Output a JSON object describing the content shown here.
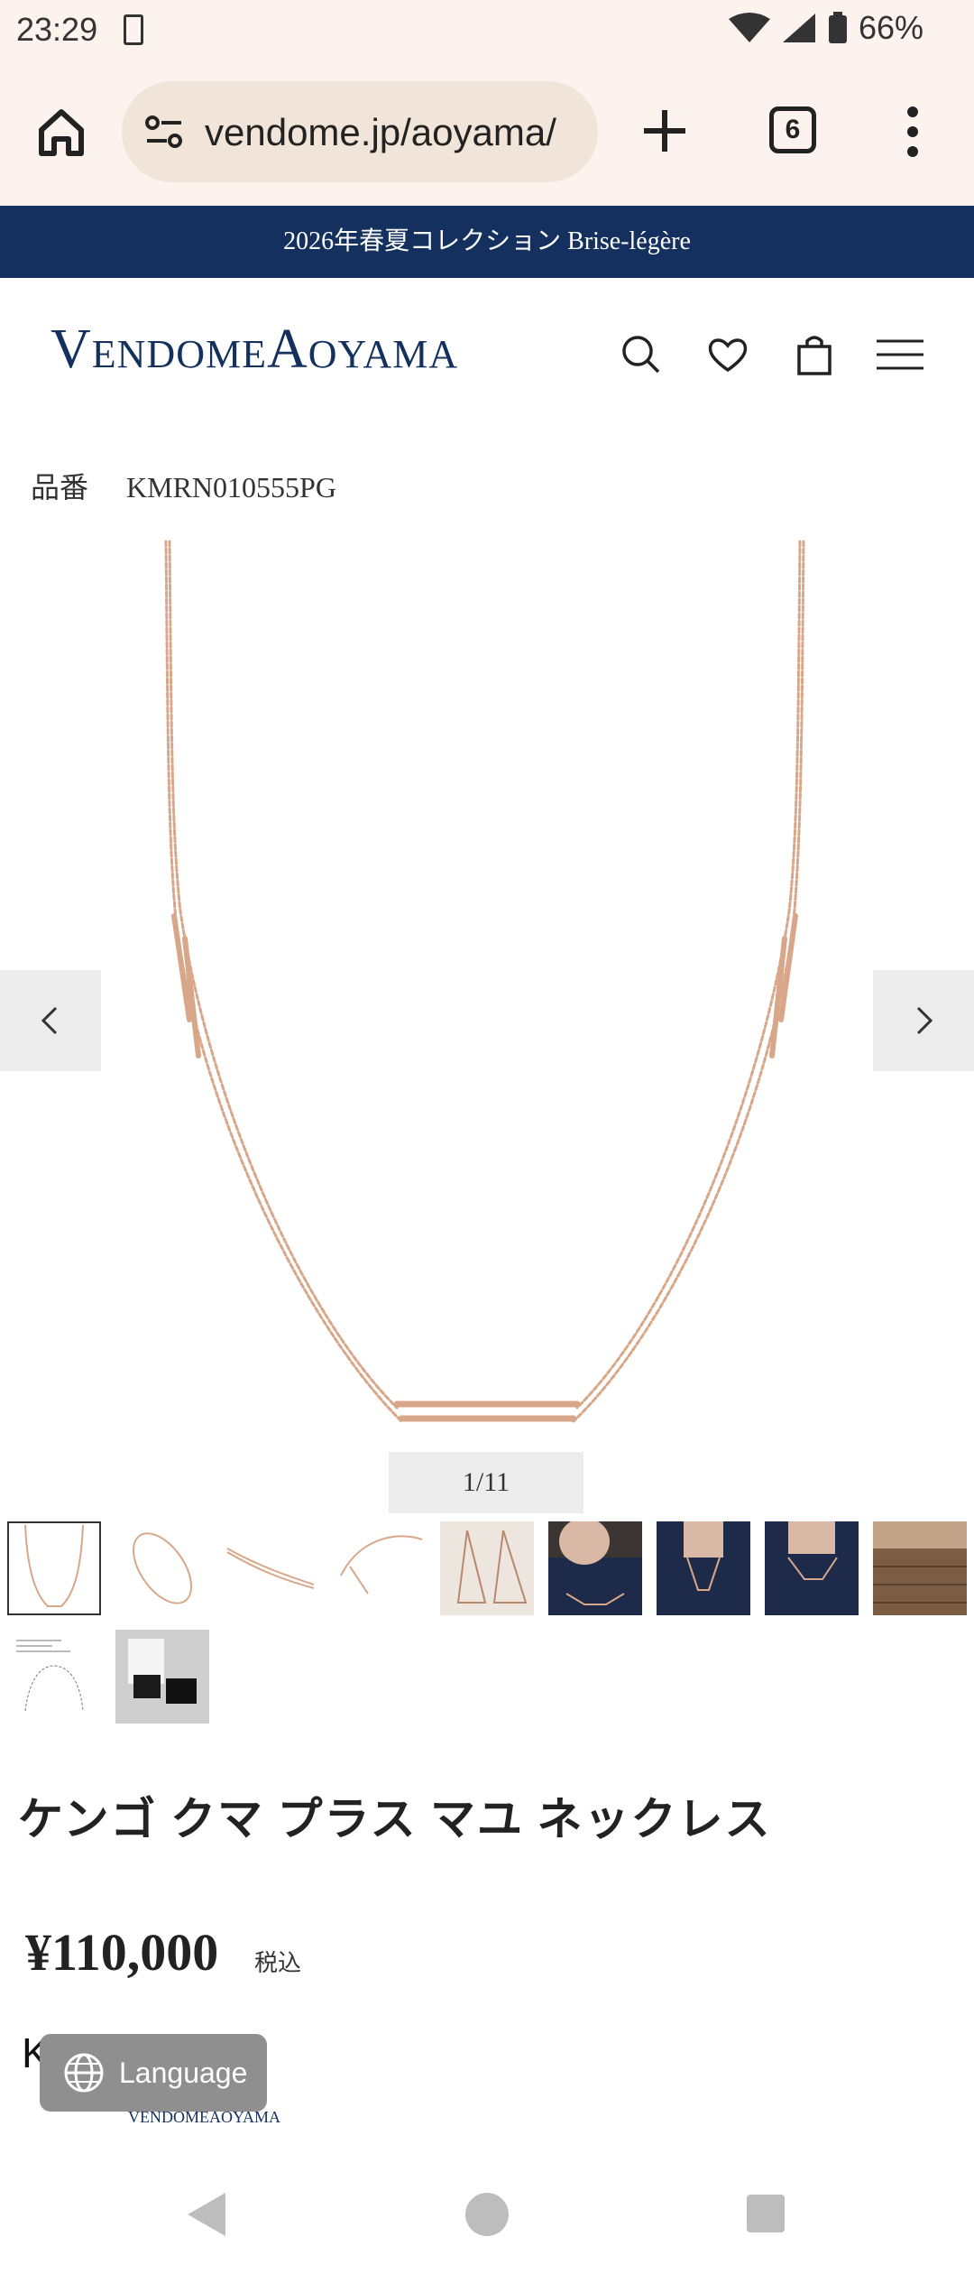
{
  "status_bar": {
    "time": "23:29",
    "battery": "66%"
  },
  "browser": {
    "url": "vendome.jp/aoyama/",
    "tab_count": "6"
  },
  "announcement": "2026年春夏コレクション Brise-légère",
  "header": {
    "logo_v": "V",
    "logo_endome": "ENDOME",
    "logo_a": "A",
    "logo_oyama": "OYAMA"
  },
  "product": {
    "code_label": "品番",
    "code": "KMRN010555PG",
    "image_counter": "1/11",
    "name": "ケンゴ クマ プラス マユ ネックレス",
    "price": "¥110,000",
    "tax_label": "税込",
    "brand_partial": "K           M   U"
  },
  "thumbnails_count": 11,
  "language_button": "Language",
  "mini_logo": "VENDOMEAOYAMA",
  "colors": {
    "navy": "#13305e",
    "chain_gold": "#d8a688",
    "browser_bg": "#fdf3ee"
  },
  "icons": [
    "home-icon",
    "site-settings-icon",
    "plus-icon",
    "tabs-icon",
    "more-icon",
    "search-icon",
    "heart-icon",
    "bag-icon",
    "hamburger-icon",
    "chevron-left-icon",
    "chevron-right-icon",
    "globe-icon"
  ]
}
